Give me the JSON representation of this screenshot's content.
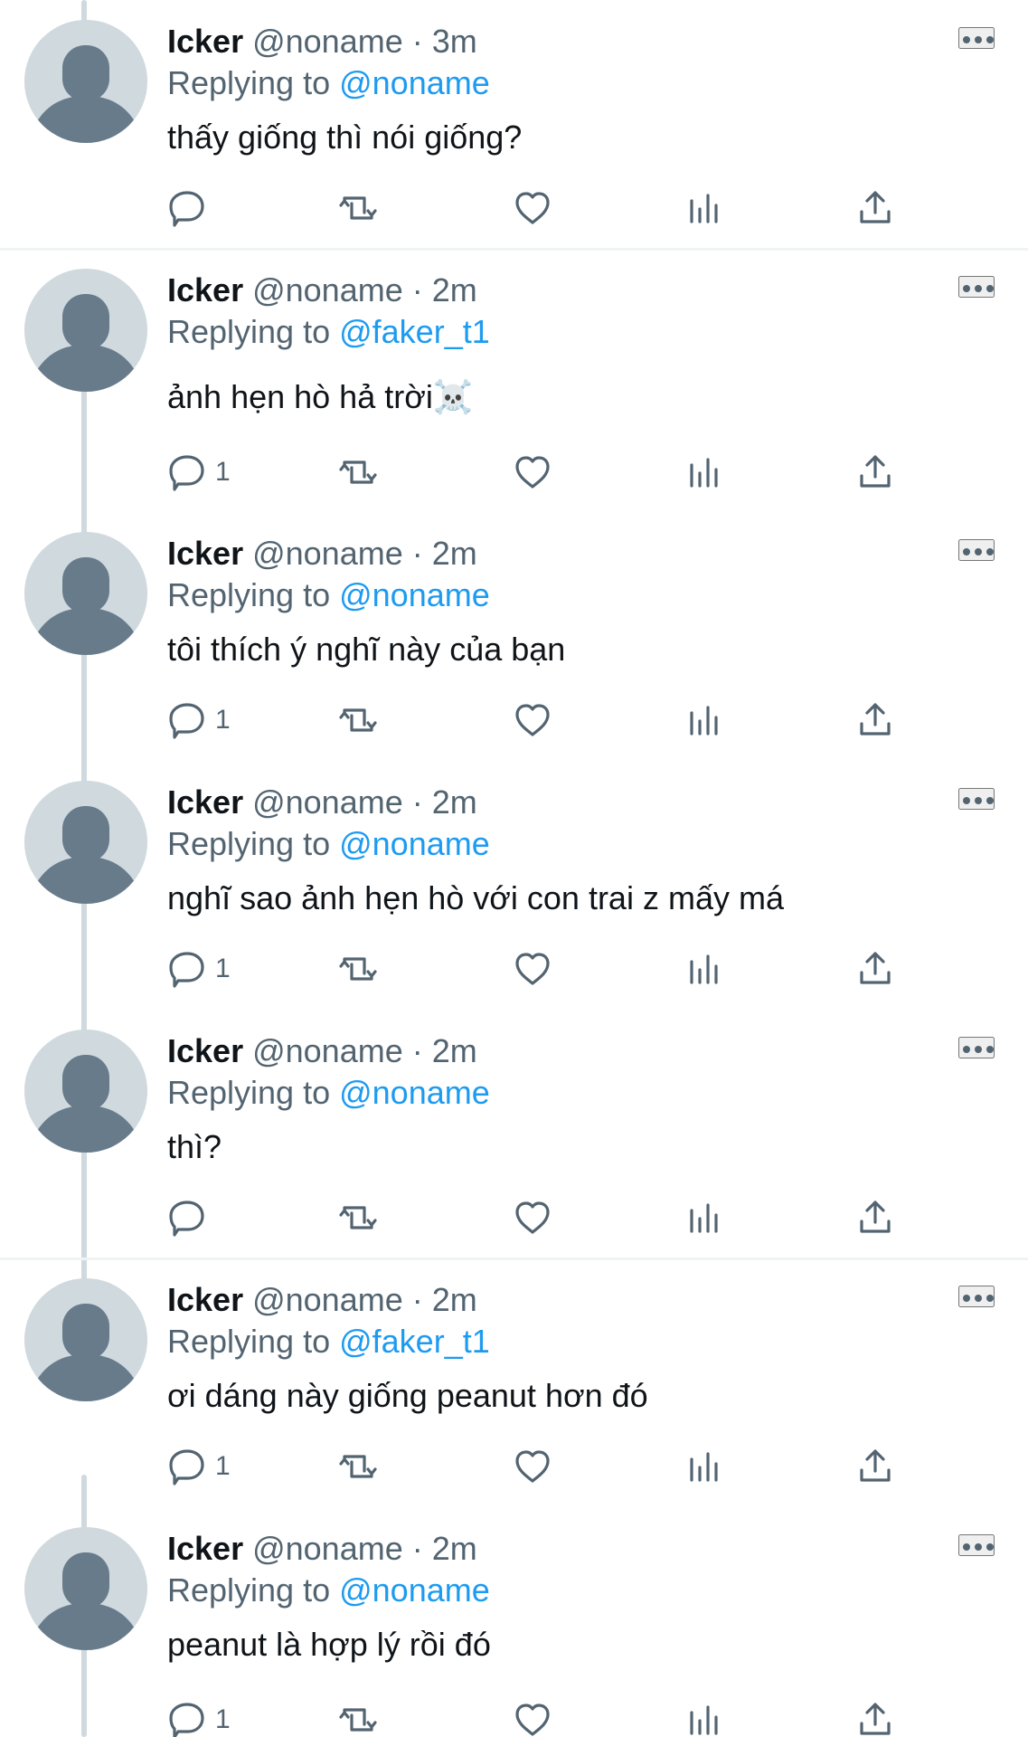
{
  "tweets": [
    {
      "name": "Icker",
      "handle": "@noname",
      "time": "3m",
      "replying_prefix": "Replying to ",
      "replying_to": "@noname",
      "text": "thấy giống thì nói giống?",
      "reply_count": ""
    },
    {
      "name": "Icker",
      "handle": "@noname",
      "time": "2m",
      "replying_prefix": "Replying to ",
      "replying_to": "@faker_t1",
      "text": "ảnh hẹn hò hả trời☠️",
      "reply_count": "1"
    },
    {
      "name": "Icker",
      "handle": "@noname",
      "time": "2m",
      "replying_prefix": "Replying to ",
      "replying_to": "@noname",
      "text": "tôi thích ý nghĩ này của bạn",
      "reply_count": "1"
    },
    {
      "name": "Icker",
      "handle": "@noname",
      "time": "2m",
      "replying_prefix": "Replying to ",
      "replying_to": "@noname",
      "text": "nghĩ sao ảnh hẹn hò với con trai z mấy má",
      "reply_count": "1"
    },
    {
      "name": "Icker",
      "handle": "@noname",
      "time": "2m",
      "replying_prefix": "Replying to ",
      "replying_to": "@noname",
      "text": "thì?",
      "reply_count": ""
    },
    {
      "name": "Icker",
      "handle": "@noname",
      "time": "2m",
      "replying_prefix": "Replying to ",
      "replying_to": "@faker_t1",
      "text": "ơi dáng này giống peanut hơn đó",
      "reply_count": "1"
    },
    {
      "name": "Icker",
      "handle": "@noname",
      "time": "2m",
      "replying_prefix": "Replying to ",
      "replying_to": "@noname",
      "text": "peanut là hợp lý rồi đó",
      "reply_count": "1"
    }
  ],
  "separator": " · ",
  "icons": {
    "avatar": "default-profile-icon",
    "more": "more-options-icon",
    "reply": "reply-icon",
    "retweet": "retweet-icon",
    "like": "heart-icon",
    "views": "analytics-icon",
    "share": "share-icon"
  },
  "colors": {
    "name": "#0f1419",
    "secondary": "#536471",
    "link": "#1d9bf0",
    "thread_line": "#cfd9de",
    "divider": "#eff3f4",
    "avatar_background": "#cfd9de",
    "avatar_figure": "#687b8b"
  }
}
